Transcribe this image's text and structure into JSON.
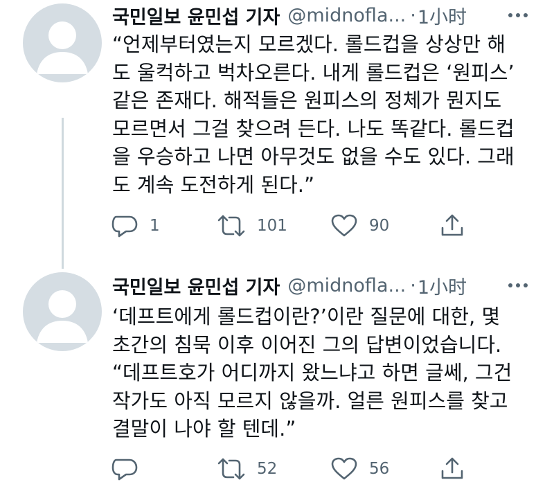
{
  "tweets": [
    {
      "author_name": "국민일보 윤민섭 기자",
      "handle": "@midnofla...",
      "separator": "·",
      "time": "1小时",
      "body_lines": [
        "“언제부터였는지 모르겠다. 롤드컵을 상상만 해",
        "도 울컥하고 벅차오른다. 내게 롤드컵은 ‘원피스’",
        "같은 존재다. 해적들은 원피스의 정체가 뭔지도",
        "모르면서 그걸 찾으려 든다. 나도 똑같다. 롤드컵",
        "을 우승하고 나면 아무것도 없을 수도 있다. 그래",
        "도 계속 도전하게 된다.”"
      ],
      "replies": "1",
      "retweets": "101",
      "likes": "90"
    },
    {
      "author_name": "국민일보 윤민섭 기자",
      "handle": "@midnofla...",
      "separator": "·",
      "time": "1小时",
      "body_lines": [
        "‘데프트에게 롤드컵이란?’이란 질문에 대한, 몇",
        "초간의 침묵 이후 이어진 그의 답변이었습니다.",
        "“데프트호가 어디까지 왔느냐고 하면 글쎄, 그건",
        "작가도 아직 모르지 않을까. 얼른 원피스를 찾고",
        "결말이 나야 할 텐데.”"
      ],
      "replies": "",
      "retweets": "52",
      "likes": "56"
    }
  ],
  "icons": {
    "more": "more-dots-icon",
    "reply": "reply-icon",
    "retweet": "retweet-icon",
    "like": "like-icon",
    "share": "share-icon"
  },
  "colors": {
    "text": "#0f1419",
    "secondary": "#536471",
    "thread_line": "#cfd9de",
    "avatar_bg": "#d5dde3",
    "avatar_fg": "#ffffff"
  }
}
